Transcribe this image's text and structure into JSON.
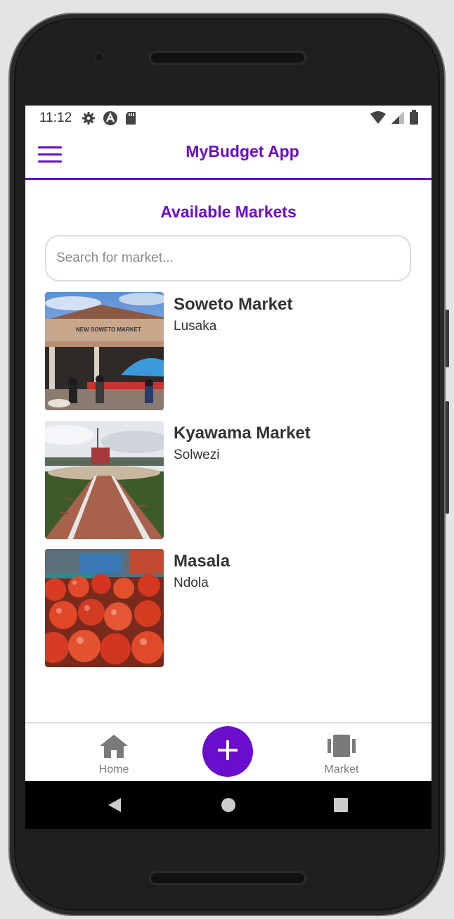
{
  "status_bar": {
    "time": "11:12",
    "left_icons": [
      "gear-icon",
      "a-circle-icon",
      "sd-card-icon"
    ],
    "right_icons": [
      "wifi-icon",
      "signal-icon",
      "battery-icon"
    ]
  },
  "app_bar": {
    "title": "MyBudget App",
    "menu_icon": "hamburger-menu-icon"
  },
  "page": {
    "section_title": "Available Markets",
    "search": {
      "placeholder": "Search for market...",
      "value": ""
    }
  },
  "markets": [
    {
      "name": "Soweto Market",
      "city": "Lusaka",
      "image": "market-building-photo"
    },
    {
      "name": "Kyawama Market",
      "city": "Solwezi",
      "image": "paved-walkway-photo"
    },
    {
      "name": "Masala",
      "city": "Ndola",
      "image": "tomatoes-photo"
    }
  ],
  "bottom_nav": {
    "home_label": "Home",
    "market_label": "Market",
    "fab_icon": "plus-icon"
  },
  "colors": {
    "accent": "#6a0dcc",
    "text": "#333333",
    "nav_gray": "#7a7a7a"
  }
}
